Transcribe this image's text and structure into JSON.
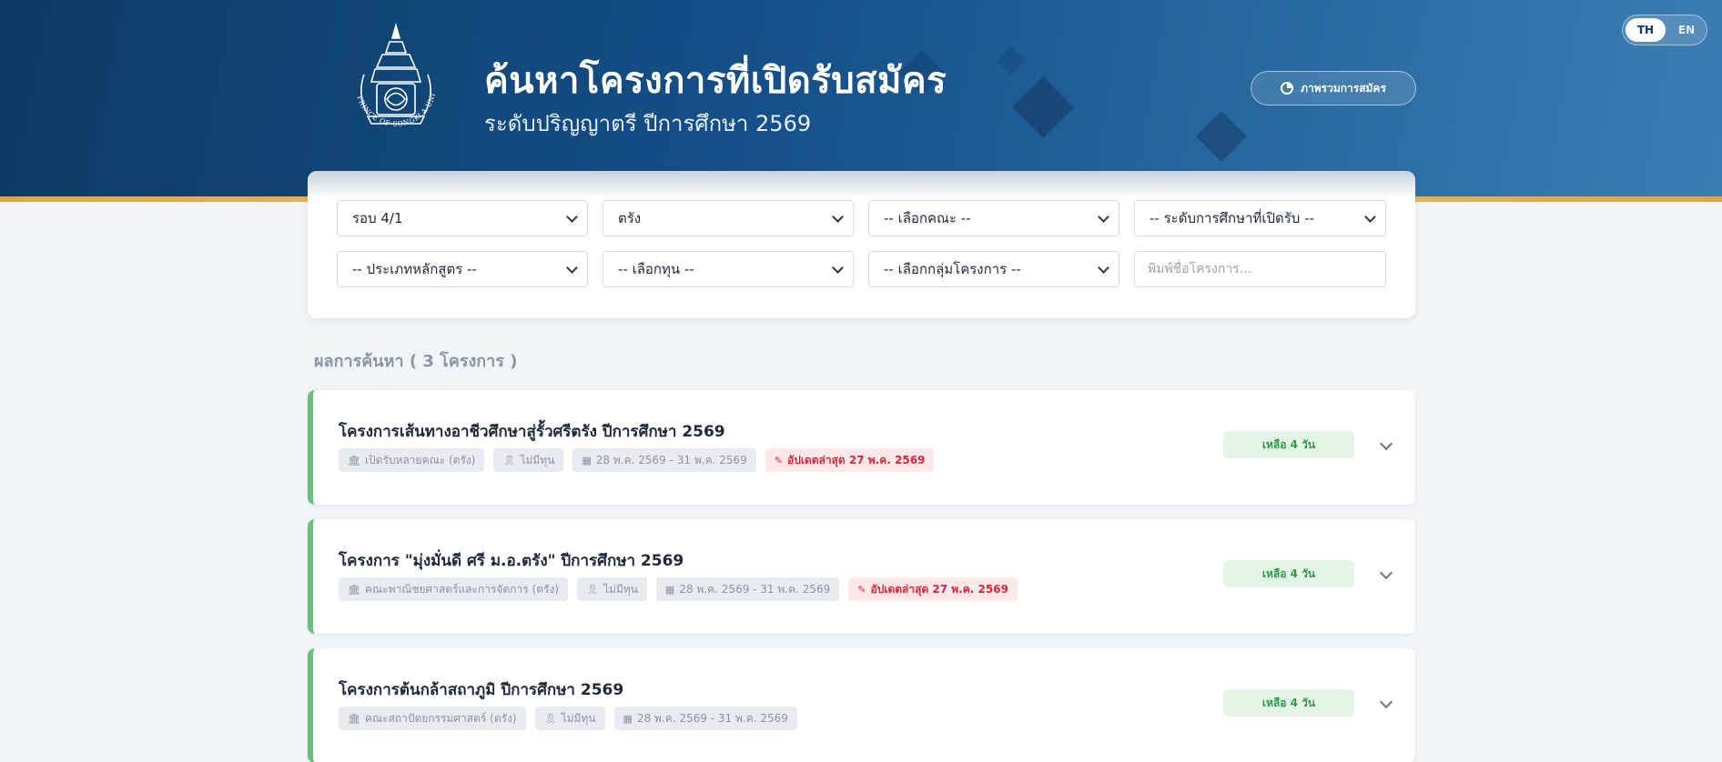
{
  "header": {
    "title": "ค้นหาโครงการที่เปิดรับสมัคร",
    "subtitle": "ระดับปริญญาตรี ปีการศึกษา 2569",
    "logo_text": "PRINCE OF SONGKLA UNIVERSITY",
    "overview_button": "ภาพรวมการสมัคร",
    "lang": {
      "th": "TH",
      "en": "EN",
      "active": "TH"
    }
  },
  "filters": {
    "round": "รอบ 4/1",
    "campus": "ตรัง",
    "faculty": "-- เลือกคณะ --",
    "level": "-- ระดับการศึกษาที่เปิดรับ --",
    "curriculum_type": "-- ประเภทหลักสูตร --",
    "scholarship": "-- เลือกทุน --",
    "project_group": "-- เลือกกลุ่มโครงการ --",
    "search_placeholder": "พิมพ์ชื่อโครงการ..."
  },
  "results": {
    "heading": "ผลการค้นหา ( 3 โครงการ )",
    "items": [
      {
        "title": "โครงการเส้นทางอาชีวศึกษาสู่รั้วศรีตรัง ปีการศึกษา 2569",
        "faculty": "เปิดรับหลายคณะ (ตรัง)",
        "scholarship": "ไม่มีทุน",
        "dates": "28 พ.ค. 2569 - 31 พ.ค. 2569",
        "updated": "อัปเดตล่าสุด 27 พ.ค. 2569",
        "remaining": "เหลือ 4 วัน"
      },
      {
        "title": "โครงการ \"มุ่งมั่นดี ศรี ม.อ.ตรัง\" ปีการศึกษา 2569",
        "faculty": "คณะพาณิชยศาสตร์และการจัดการ (ตรัง)",
        "scholarship": "ไม่มีทุน",
        "dates": "28 พ.ค. 2569 - 31 พ.ค. 2569",
        "updated": "อัปเดตล่าสุด 27 พ.ค. 2569",
        "remaining": "เหลือ 4 วัน"
      },
      {
        "title": "โครงการต้นกล้าสถาภูมิ ปีการศึกษา 2569",
        "faculty": "คณะสถาปัตยกรรมศาสตร์ (ตรัง)",
        "scholarship": "ไม่มีทุน",
        "dates": "28 พ.ค. 2569 - 31 พ.ค. 2569",
        "remaining": "เหลือ 4 วัน"
      }
    ]
  },
  "colors": {
    "header_blue": "#15508a",
    "accent_gold": "#d8a64f",
    "card_accent_green": "#66c27a",
    "badge_green": "#2f9a47",
    "update_red": "#d8283b"
  },
  "icons": {
    "faculty": "bank-icon",
    "scholarship": "award-icon",
    "dates": "calendar-icon",
    "updated": "edit-icon",
    "expand": "chevron-down-icon",
    "overview": "pie-chart-icon"
  }
}
